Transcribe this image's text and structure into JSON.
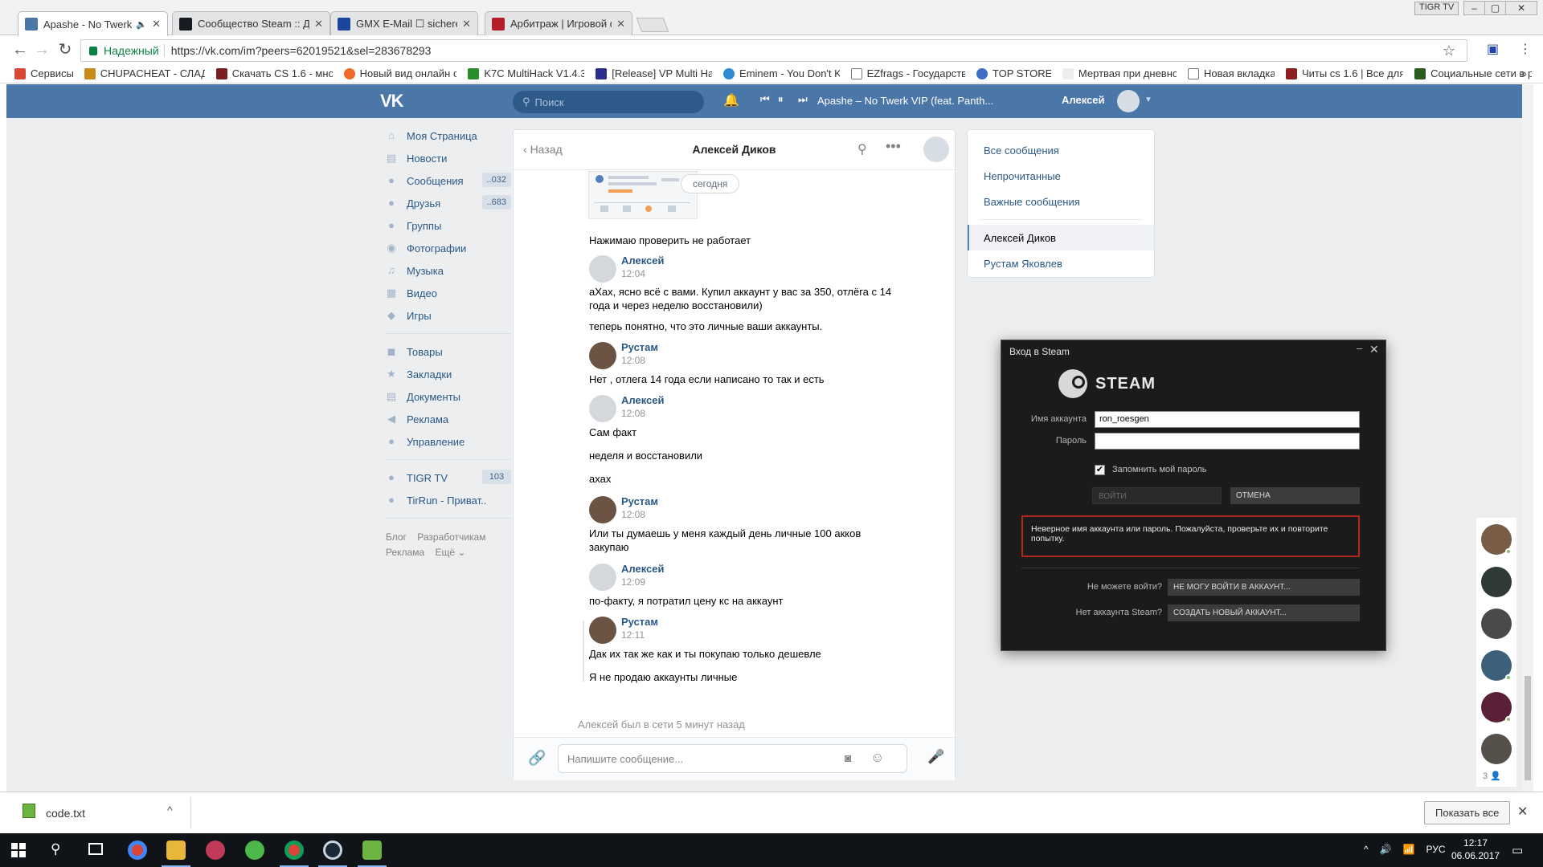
{
  "browser": {
    "tabs": [
      {
        "title": "Apashe - No Twerk VI",
        "active": true,
        "muted_icon": "🔈"
      },
      {
        "title": "Сообщество Steam :: Де",
        "active": false
      },
      {
        "title": "GMX E-Mail ☐ sichere E",
        "active": false
      },
      {
        "title": "Арбитраж | Игровой фо",
        "active": false
      }
    ],
    "profile_button": "TIGR TV",
    "window_controls": {
      "minimize": "–",
      "maximize": "▢",
      "close": "✕"
    },
    "secure_label": "Надежный",
    "url": "https://vk.com/im?peers=62019521&sel=283678293",
    "bookmarks": [
      "Сервисы",
      "CHUPACHEAT - СЛАД",
      "Скачать CS 1.6 - мно",
      "Новый вид онлайн с",
      "K7C MultiHack V1.4.3",
      "[Release] VP Multi Ha",
      "Eminem - You Don't K",
      "EZfrags - Государств",
      "TOP STORE",
      "Мертвая при дневно",
      "Новая вкладка",
      "Читы cs 1.6 | Все для",
      "Социальные сети в р"
    ],
    "bookmarks_more": "»",
    "nav": {
      "back": "←",
      "forward": "→",
      "reload": "↻",
      "star": "☆"
    }
  },
  "vk": {
    "logo": "VK",
    "search_placeholder": "Поиск",
    "player": {
      "prev": "⏮",
      "pause": "⏸",
      "next": "⏭",
      "track": "Apashe – No Twerk VIP (feat. Panth..."
    },
    "user_name": "Алексей",
    "left_nav": [
      {
        "label": "Моя Страница",
        "icon": "⌂"
      },
      {
        "label": "Новости",
        "icon": "▤"
      },
      {
        "label": "Сообщения",
        "icon": "●",
        "count": "..032"
      },
      {
        "label": "Друзья",
        "icon": "●",
        "count": "..683"
      },
      {
        "label": "Группы",
        "icon": "●"
      },
      {
        "label": "Фотографии",
        "icon": "◉"
      },
      {
        "label": "Музыка",
        "icon": "♫"
      },
      {
        "label": "Видео",
        "icon": "▦"
      },
      {
        "label": "Игры",
        "icon": "◆"
      }
    ],
    "left_nav_2": [
      {
        "label": "Товары",
        "icon": "◼"
      },
      {
        "label": "Закладки",
        "icon": "★"
      },
      {
        "label": "Документы",
        "icon": "▤"
      },
      {
        "label": "Реклама",
        "icon": "◀"
      },
      {
        "label": "Управление",
        "icon": "●"
      }
    ],
    "left_nav_groups": [
      {
        "label": "TIGR TV",
        "icon": "●",
        "count": "103"
      },
      {
        "label": "TirRun - Приват..",
        "icon": "●"
      }
    ],
    "footer": {
      "blog": "Блог",
      "dev": "Разработчикам",
      "ads": "Реклама",
      "more": "Ещё ⌄"
    },
    "chat": {
      "back_label": "Назад",
      "title": "Алексей Диков",
      "today_badge": "сегодня",
      "messages": {
        "m1": "Нажимаю проверить не работает",
        "a1": "Алексей",
        "t1": "12:04",
        "m2": "аХах, ясно всё с вами. Купил аккаунт у вас за 350, отлёга с 14 года и через неделю восстановили)",
        "m3": "теперь понятно, что это личные ваши аккаунты.",
        "a2": "Рустам",
        "t2": "12:08",
        "m4": "Нет , отлега 14 года если написано то так и есть",
        "a3": "Алексей",
        "t3": "12:08",
        "m5": "Сам факт",
        "m6": "неделя и восстановили",
        "m7": "ахах",
        "a4": "Рустам",
        "t4": "12:08",
        "m8": "Или ты думаешь у меня каждый день личные 100 акков закупаю",
        "a5": "Алексей",
        "t5": "12:09",
        "m9": "по-факту, я потратил цену кс на аккаунт",
        "a6": "Рустам",
        "t6": "12:11",
        "m10": "Дак их так же как и ты покупаю только дешевле",
        "m11": "Я не продаю аккаунты личные"
      },
      "online_status": "Алексей был в сети 5 минут назад",
      "input_placeholder": "Напишите сообщение..."
    },
    "right_menu": {
      "all": "Все сообщения",
      "unread": "Непрочитанные",
      "important": "Важные сообщения",
      "dialog1": "Алексей Диков",
      "dialog2": "Рустам Яковлев"
    },
    "dock_count": "3 👤"
  },
  "steam": {
    "window_title": "Вход в Steam",
    "logo_text": "STEAM",
    "account_label": "Имя аккаунта",
    "account_value": "ron_roesgen",
    "password_label": "Пароль",
    "password_value": "",
    "remember_label": "Запомнить мой пароль",
    "remember_checked": "✔",
    "login_button": "ВОЙТИ",
    "cancel_button": "ОТМЕНА",
    "error_text": "Неверное имя аккаунта или пароль. Пожалуйста, проверьте их и повторите попытку.",
    "cant_login_label": "Не можете войти?",
    "cant_login_button": "НЕ МОГУ ВОЙТИ В АККАУНТ...",
    "no_account_label": "Нет аккаунта Steam?",
    "create_button": "СОЗДАТЬ НОВЫЙ АККАУНТ...",
    "minimize": "–",
    "close": "✕"
  },
  "downloads": {
    "file_name": "code.txt",
    "show_all": "Показать все",
    "caret": "^",
    "close": "✕"
  },
  "taskbar": {
    "search_icon": "⚲",
    "tray_lang": "РУС",
    "time": "12:17",
    "date": "06.06.2017",
    "notification_icon": "▭"
  },
  "colors": {
    "vk_header": "#4a76a8",
    "vk_link": "#2a5885",
    "steam_bg": "#1b1b1b",
    "steam_error_border": "#b3261e"
  }
}
